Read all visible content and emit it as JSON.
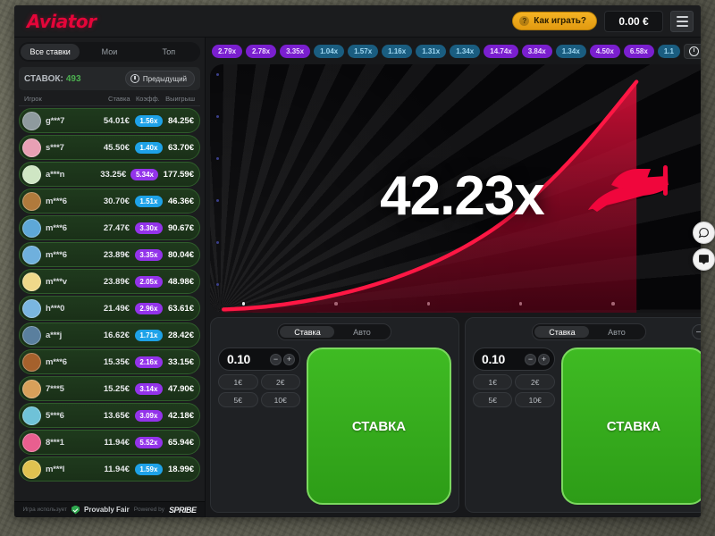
{
  "header": {
    "logo": "Aviator",
    "howto_label": "Как играть?",
    "howto_icon": "question-icon",
    "balance": "0.00 €",
    "menu_icon": "hamburger-icon"
  },
  "sidebar": {
    "tabs": [
      {
        "label": "Все ставки",
        "active": true
      },
      {
        "label": "Мои",
        "active": false
      },
      {
        "label": "Топ",
        "active": false
      }
    ],
    "bets_label": "СТАВОК:",
    "bets_count": "493",
    "prev_button": "Предыдущий",
    "prev_icon": "history-clock-icon",
    "columns": [
      "Игрок",
      "Ставка",
      "Коэфф.",
      "Выигрыш"
    ],
    "rows": [
      {
        "player": "g***7",
        "bet": "54.01€",
        "mult": "1.56x",
        "mult_color": "blue",
        "win": "84.25€",
        "avatar": "#8e9a9e"
      },
      {
        "player": "s***7",
        "bet": "45.50€",
        "mult": "1.40x",
        "mult_color": "blue",
        "win": "63.70€",
        "avatar": "#e8a0b4"
      },
      {
        "player": "a***n",
        "bet": "33.25€",
        "mult": "5.34x",
        "mult_color": "purple",
        "win": "177.59€",
        "avatar": "#cfe6c4"
      },
      {
        "player": "m***6",
        "bet": "30.70€",
        "mult": "1.51x",
        "mult_color": "blue",
        "win": "46.36€",
        "avatar": "#b07a3c"
      },
      {
        "player": "m***6",
        "bet": "27.47€",
        "mult": "3.30x",
        "mult_color": "purple",
        "win": "90.67€",
        "avatar": "#5ea8d8"
      },
      {
        "player": "m***6",
        "bet": "23.89€",
        "mult": "3.35x",
        "mult_color": "purple",
        "win": "80.04€",
        "avatar": "#6fb0dd"
      },
      {
        "player": "m***v",
        "bet": "23.89€",
        "mult": "2.05x",
        "mult_color": "purple",
        "win": "48.98€",
        "avatar": "#efd98a"
      },
      {
        "player": "h***0",
        "bet": "21.49€",
        "mult": "2.96x",
        "mult_color": "purple",
        "win": "63.61€",
        "avatar": "#7ab6e0"
      },
      {
        "player": "a***j",
        "bet": "16.62€",
        "mult": "1.71x",
        "mult_color": "blue",
        "win": "28.42€",
        "avatar": "#5a7f9e"
      },
      {
        "player": "m***6",
        "bet": "15.35€",
        "mult": "2.16x",
        "mult_color": "purple",
        "win": "33.15€",
        "avatar": "#a5612c"
      },
      {
        "player": "7***5",
        "bet": "15.25€",
        "mult": "3.14x",
        "mult_color": "purple",
        "win": "47.90€",
        "avatar": "#d8a05a"
      },
      {
        "player": "5***6",
        "bet": "13.65€",
        "mult": "3.09x",
        "mult_color": "purple",
        "win": "42.18€",
        "avatar": "#6fc2d8"
      },
      {
        "player": "8***1",
        "bet": "11.94€",
        "mult": "5.52x",
        "mult_color": "purple",
        "win": "65.94€",
        "avatar": "#e85f8f"
      },
      {
        "player": "m***l",
        "bet": "11.94€",
        "mult": "1.59x",
        "mult_color": "blue",
        "win": "18.99€",
        "avatar": "#e0c250"
      }
    ],
    "footer": {
      "uses": "Игра использует",
      "fair": "Provably Fair",
      "shield_icon": "shield-check-icon",
      "powered": "Powered by",
      "brand": "SPRIBE"
    }
  },
  "history": {
    "chips": [
      {
        "value": "2.79x",
        "color": "purple"
      },
      {
        "value": "2.78x",
        "color": "purple"
      },
      {
        "value": "3.35x",
        "color": "purple"
      },
      {
        "value": "1.04x",
        "color": "blue"
      },
      {
        "value": "1.57x",
        "color": "blue"
      },
      {
        "value": "1.16x",
        "color": "blue"
      },
      {
        "value": "1.31x",
        "color": "blue"
      },
      {
        "value": "1.34x",
        "color": "blue"
      },
      {
        "value": "14.74x",
        "color": "purple"
      },
      {
        "value": "3.84x",
        "color": "purple"
      },
      {
        "value": "1.34x",
        "color": "blue"
      },
      {
        "value": "4.50x",
        "color": "purple"
      },
      {
        "value": "6.58x",
        "color": "purple"
      },
      {
        "value": "1.1",
        "color": "blue"
      }
    ],
    "history_icon": "history-clock-icon",
    "caret_icon": "chevron-down-icon"
  },
  "game": {
    "multiplier": "42.23x",
    "plane_icon": "airplane-icon",
    "curve_color": "#e8113c",
    "accent_color": "#e50539"
  },
  "bet_panels": [
    {
      "tabs": [
        {
          "label": "Ставка",
          "active": true
        },
        {
          "label": "Авто",
          "active": false
        }
      ],
      "amount": "0.10",
      "minus_icon": "minus-icon",
      "plus_icon": "plus-icon",
      "quick_amounts": [
        "1€",
        "2€",
        "5€",
        "10€"
      ],
      "bet_button": "СТАВКА"
    },
    {
      "tabs": [
        {
          "label": "Ставка",
          "active": true
        },
        {
          "label": "Авто",
          "active": false
        }
      ],
      "amount": "0.10",
      "minus_icon": "minus-icon",
      "plus_icon": "plus-icon",
      "quick_amounts": [
        "1€",
        "2€",
        "5€",
        "10€"
      ],
      "bet_button": "СТАВКА",
      "collapse_icon": "minus-circle-icon"
    }
  ],
  "float_buttons": [
    {
      "icon": "chat-bubble-icon"
    },
    {
      "icon": "support-chat-icon"
    }
  ]
}
